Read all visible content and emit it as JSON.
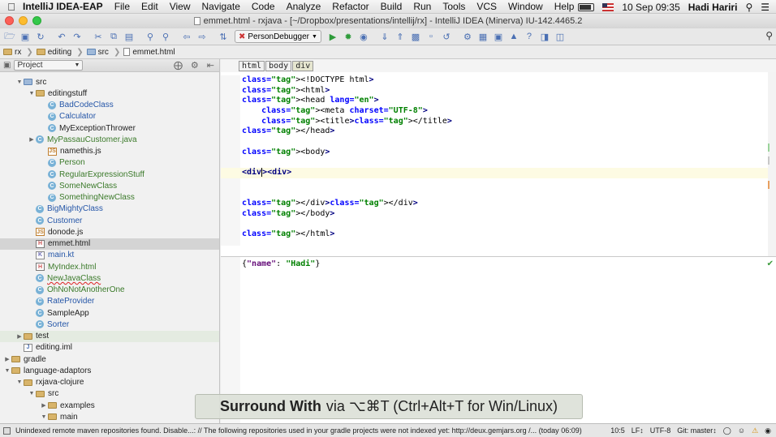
{
  "menubar": {
    "app_name": "IntelliJ IDEA-EAP",
    "items": [
      "File",
      "Edit",
      "View",
      "Navigate",
      "Code",
      "Analyze",
      "Refactor",
      "Build",
      "Run",
      "Tools",
      "VCS",
      "Window",
      "Help"
    ],
    "datetime": "10 Sep  09:35",
    "user": "Hadi Hariri"
  },
  "window": {
    "title": "emmet.html - rxjava - [~/Dropbox/presentations/intellij/rx] - IntelliJ IDEA (Minerva) IU-142.4465.2"
  },
  "toolbar": {
    "run_config": "PersonDebugger"
  },
  "breadcrumbs": [
    "rx",
    "editing",
    "src",
    "emmet.html"
  ],
  "project_panel": {
    "selector_label": "Project",
    "tree": [
      {
        "label": "src",
        "type": "src",
        "level": 1,
        "arrow": "open",
        "style": ""
      },
      {
        "label": "editingstuff",
        "type": "folder",
        "level": 2,
        "arrow": "open",
        "style": ""
      },
      {
        "label": "BadCodeClass",
        "type": "cls",
        "level": 3,
        "arrow": "",
        "style": "blue"
      },
      {
        "label": "Calculator",
        "type": "cls",
        "level": 3,
        "arrow": "",
        "style": "blue"
      },
      {
        "label": "MyExceptionThrower",
        "type": "cls",
        "level": 3,
        "arrow": "",
        "style": ""
      },
      {
        "label": "MyPassauCustomer.java",
        "type": "cls",
        "level": 2,
        "arrow": "closed",
        "style": "green",
        "offset": 1
      },
      {
        "label": "namethis.js",
        "type": "js",
        "level": 3,
        "arrow": "",
        "style": ""
      },
      {
        "label": "Person",
        "type": "cls",
        "level": 3,
        "arrow": "",
        "style": "green"
      },
      {
        "label": "RegularExpressionStuff",
        "type": "cls",
        "level": 3,
        "arrow": "",
        "style": "green"
      },
      {
        "label": "SomeNewClass",
        "type": "cls",
        "level": 3,
        "arrow": "",
        "style": "green"
      },
      {
        "label": "SomethingNewClass",
        "type": "cls",
        "level": 3,
        "arrow": "",
        "style": "green"
      },
      {
        "label": "BigMightyClass",
        "type": "cls",
        "level": 2,
        "arrow": "",
        "style": "blue"
      },
      {
        "label": "Customer",
        "type": "cls",
        "level": 2,
        "arrow": "",
        "style": "blue"
      },
      {
        "label": "donode.js",
        "type": "js",
        "level": 2,
        "arrow": "",
        "style": ""
      },
      {
        "label": "emmet.html",
        "type": "html",
        "level": 2,
        "arrow": "",
        "style": "",
        "selected": true
      },
      {
        "label": "main.kt",
        "type": "kt",
        "level": 2,
        "arrow": "",
        "style": "blue"
      },
      {
        "label": "MyIndex.html",
        "type": "html",
        "level": 2,
        "arrow": "",
        "style": "green"
      },
      {
        "label": "NewJavaClass",
        "type": "cls",
        "level": 2,
        "arrow": "",
        "style": "under"
      },
      {
        "label": "OhNoNotAnotherOne",
        "type": "cls",
        "level": 2,
        "arrow": "",
        "style": "green"
      },
      {
        "label": "RateProvider",
        "type": "cls",
        "level": 2,
        "arrow": "",
        "style": "blue"
      },
      {
        "label": "SampleApp",
        "type": "cls",
        "level": 2,
        "arrow": "",
        "style": ""
      },
      {
        "label": "Sorter",
        "type": "cls",
        "level": 2,
        "arrow": "",
        "style": "blue"
      },
      {
        "label": "test",
        "type": "folder",
        "level": 1,
        "arrow": "closed",
        "style": "",
        "hl": true
      },
      {
        "label": "editing.iml",
        "type": "iml",
        "level": 1,
        "arrow": "",
        "style": ""
      },
      {
        "label": "gradle",
        "type": "folder",
        "level": 0,
        "arrow": "closed",
        "style": ""
      },
      {
        "label": "language-adaptors",
        "type": "folder",
        "level": 0,
        "arrow": "open",
        "style": ""
      },
      {
        "label": "rxjava-clojure",
        "type": "folder",
        "level": 1,
        "arrow": "open",
        "style": ""
      },
      {
        "label": "src",
        "type": "folder",
        "level": 2,
        "arrow": "open",
        "style": ""
      },
      {
        "label": "examples",
        "type": "folder",
        "level": 3,
        "arrow": "closed",
        "style": ""
      },
      {
        "label": "main",
        "type": "folder",
        "level": 3,
        "arrow": "open",
        "style": ""
      }
    ]
  },
  "editor": {
    "breadcrumb_tabs": [
      "html",
      "body",
      "div"
    ],
    "lines": [
      "<!DOCTYPE html>",
      "<html>",
      "<head lang=\"en\">",
      "    <meta charset=\"UTF-8\">",
      "    <title></title>",
      "</head>",
      "",
      "<body>",
      "",
      "<div><div>",
      "",
      "",
      "</div></div>",
      "</body>",
      "",
      "</html>"
    ]
  },
  "lower_pane": {
    "key": "\"name\"",
    "value": "\"Hadi\""
  },
  "statusbar": {
    "message": "Unindexed remote maven repositories found. Disable...: // The following repositories used in your gradle projects were not indexed yet: http://deux.gemjars.org /... (today 06:09)",
    "position": "10:5",
    "line_sep": "LF↕",
    "encoding": "UTF-8",
    "vcs": "Git: master↕"
  },
  "overlay": {
    "action": "Surround With",
    "shortcut": "via ⌥⌘T (Ctrl+Alt+T for Win/Linux)"
  }
}
